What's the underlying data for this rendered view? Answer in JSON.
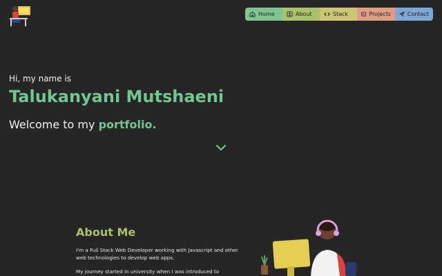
{
  "nav": {
    "items": [
      {
        "label": "Home",
        "icon": "home-icon"
      },
      {
        "label": "About",
        "icon": "about-icon"
      },
      {
        "label": "Stack",
        "icon": "code-icon"
      },
      {
        "label": "Projects",
        "icon": "terminal-icon"
      },
      {
        "label": "Contact",
        "icon": "send-icon"
      }
    ],
    "colors": [
      "#7ec58f",
      "#a9c26c",
      "#cdc676",
      "#de9e84",
      "#7fa7d3"
    ]
  },
  "hero": {
    "greeting": "Hi, my name is",
    "name": "Talukanyani Mutshaeni",
    "welcome_prefix": "Welcome to my ",
    "welcome_accent": "portfolio."
  },
  "about": {
    "title": "About Me",
    "paragraph1": "I'm a Full Stack Web Developer working with Javascript and other web technologies to develop web apps.",
    "paragraph2": "My journey started in university when I was introduced to"
  },
  "colors": {
    "background": "#262626",
    "accent_green": "#72c692",
    "about_title": "#a9c26c"
  }
}
